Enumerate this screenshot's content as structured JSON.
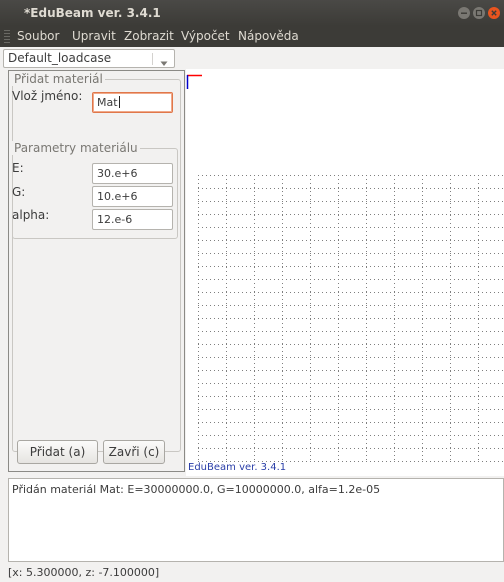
{
  "window": {
    "title": "*EduBeam ver. 3.4.1"
  },
  "menu": [
    "Soubor",
    "Upravit",
    "Zobrazit",
    "Výpočet",
    "Nápověda"
  ],
  "toolbar": {
    "loadcase": "Default_loadcase"
  },
  "panel": {
    "group_title": "Přidat materiál",
    "name_label": "Vlož jméno:",
    "name_value": "Mat",
    "params_title": "Parametry materiálu",
    "fields": [
      {
        "label": "E:",
        "value": "30.e+6"
      },
      {
        "label": "G:",
        "value": "10.e+6"
      },
      {
        "label": "alpha:",
        "value": "12.e-6"
      }
    ],
    "add_button": "Přidat (a)",
    "close_button": "Zavři (c)"
  },
  "canvas": {
    "version_label": "EduBeam ver. 3.4.1"
  },
  "log": {
    "lines": [
      "Přidán materiál Mat: E=30000000.0, G=10000000.0, alfa=1.2e-05"
    ]
  },
  "status": {
    "coords": "[x: 5.300000, z: -7.100000]"
  },
  "colors": {
    "titlebar": "#3c3b37",
    "close_button": "#e9541f",
    "focus_border": "#e0774a",
    "axis_red": "#ff0000",
    "axis_blue": "#0000cc",
    "version_text": "#2a3ea8"
  }
}
